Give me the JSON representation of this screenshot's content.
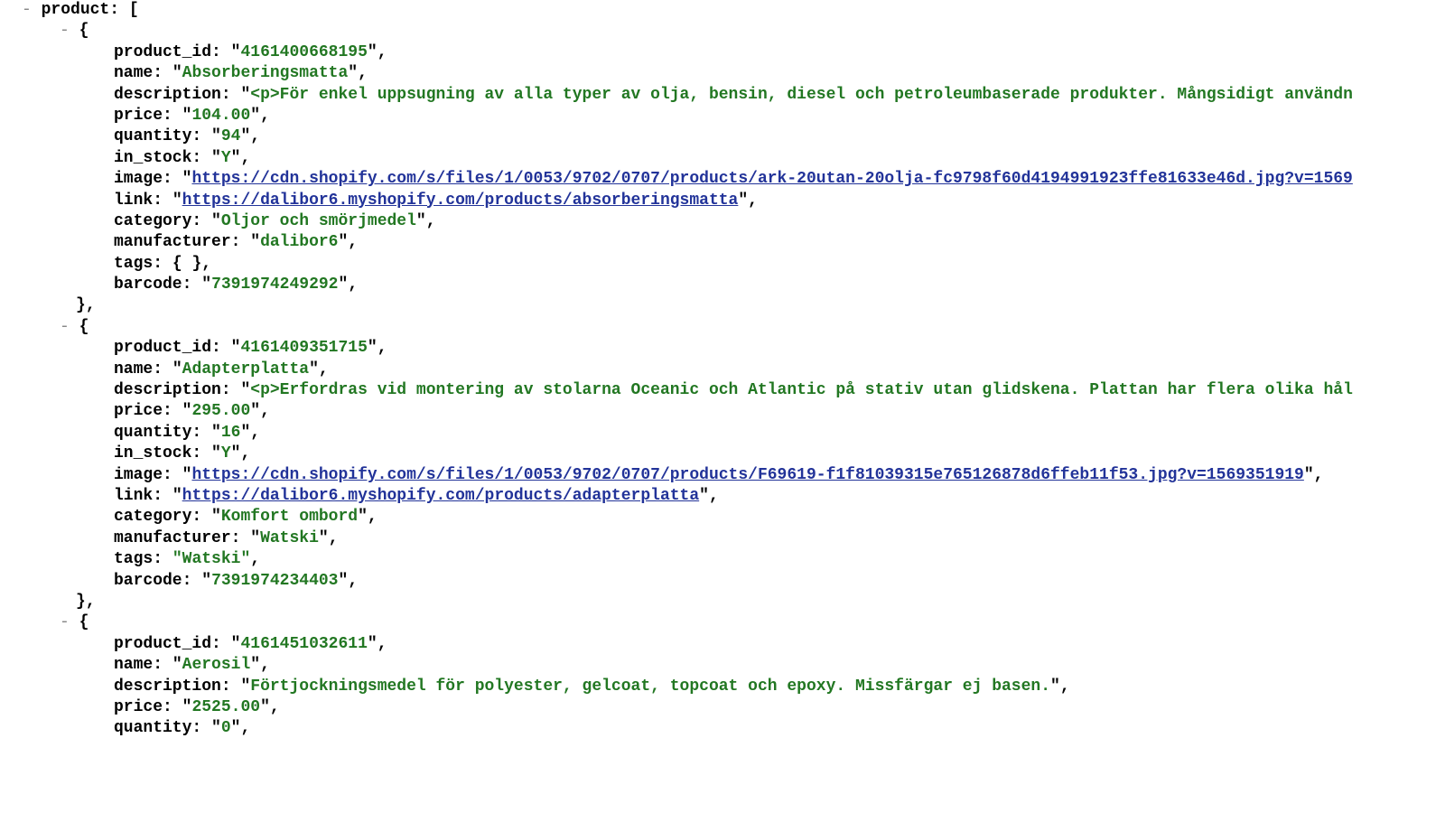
{
  "toggle": "-",
  "rootKey": "product",
  "products": [
    {
      "product_id": "4161400668195",
      "name": "Absorberingsmatta",
      "description": "<p>För enkel uppsugning av alla typer av olja, bensin, diesel och petroleumbaserade produkter. Mångsidigt användn",
      "price": "104.00",
      "quantity": "94",
      "in_stock": "Y",
      "image": "https://cdn.shopify.com/s/files/1/0053/9702/0707/products/ark-20utan-20olja-fc9798f60d4194991923ffe81633e46d.jpg?v=1569",
      "link": "https://dalibor6.myshopify.com/products/absorberingsmatta",
      "category": "Oljor och smörjmedel",
      "manufacturer": "dalibor6",
      "tags": "{ }",
      "barcode": "7391974249292"
    },
    {
      "product_id": "4161409351715",
      "name": "Adapterplatta",
      "description": "<p>Erfordras vid montering av stolarna Oceanic och Atlantic på stativ utan glidskena. Plattan har flera olika hål",
      "price": "295.00",
      "quantity": "16",
      "in_stock": "Y",
      "image": "https://cdn.shopify.com/s/files/1/0053/9702/0707/products/F69619-f1f81039315e765126878d6ffeb11f53.jpg?v=1569351919",
      "link": "https://dalibor6.myshopify.com/products/adapterplatta",
      "category": "Komfort ombord",
      "manufacturer": "Watski",
      "tags": "\"Watski\"",
      "barcode": "7391974234403"
    },
    {
      "product_id": "4161451032611",
      "name": "Aerosil",
      "description_plain": "Förtjockningsmedel för polyester, gelcoat, topcoat och epoxy. Missfärgar ej basen.",
      "price": "2525.00",
      "quantity": "0"
    }
  ],
  "labels": {
    "product_id": "product_id",
    "name": "name",
    "description": "description",
    "price": "price",
    "quantity": "quantity",
    "in_stock": "in_stock",
    "image": "image",
    "link": "link",
    "category": "category",
    "manufacturer": "manufacturer",
    "tags": "tags",
    "barcode": "barcode"
  }
}
